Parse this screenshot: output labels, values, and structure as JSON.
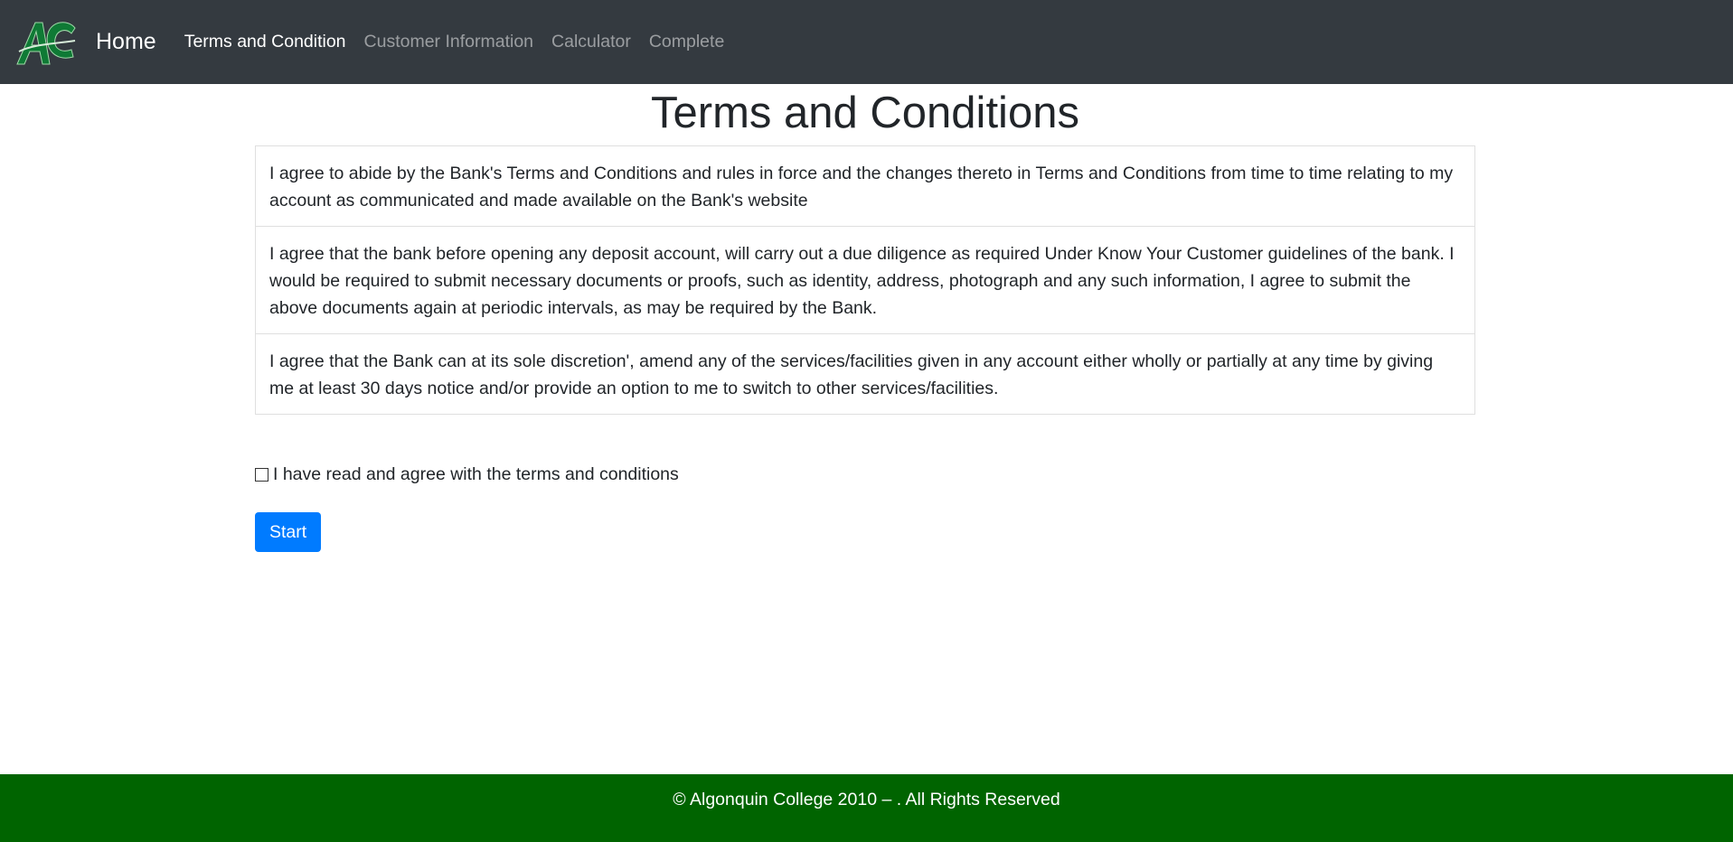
{
  "navbar": {
    "logo_icon": "algonquin-college-logo",
    "logo_text": "AC",
    "brand_label": "Home",
    "links": [
      {
        "label": "Terms and Condition",
        "active": true
      },
      {
        "label": "Customer Information",
        "active": false
      },
      {
        "label": "Calculator",
        "active": false
      },
      {
        "label": "Complete",
        "active": false
      }
    ],
    "background_color": "#343a40"
  },
  "main": {
    "title": "Terms and Conditions",
    "terms": [
      "I agree to abide by the Bank's Terms and Conditions and rules in force and the changes thereto in Terms and Conditions from time to time relating to my account as communicated and made available on the Bank's website",
      "I agree that the bank before opening any deposit account, will carry out a due diligence as required Under Know Your Customer guidelines of the bank. I would be required to submit necessary documents or proofs, such as identity, address, photograph and any such information, I agree to submit the above documents again at periodic intervals, as may be required by the Bank.",
      "I agree that the Bank can at its sole discretion', amend any of the services/facilities given in any account either wholly or partially at any time by giving me at least 30 days notice and/or provide an option to me to switch to other services/facilities."
    ],
    "agree_label": "I have read and agree with the terms and conditions",
    "agree_checked": false,
    "start_label": "Start",
    "start_color": "#007bff"
  },
  "footer": {
    "text": "© Algonquin College 2010 – . All Rights Reserved",
    "background_color": "#006400"
  }
}
